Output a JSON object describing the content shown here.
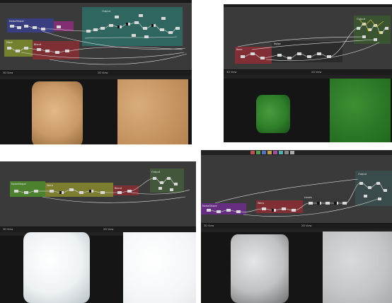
{
  "panels": [
    {
      "frames": [
        "Output",
        "NoiseShape",
        "Blend",
        "Mask"
      ],
      "bar_left": "3D View",
      "bar_right": "2D View"
    },
    {
      "frames": [
        "Output",
        "Base",
        "Noise"
      ],
      "bar_left": "3D View",
      "bar_right": "2D View"
    },
    {
      "frames": [
        "Output",
        "NoiseShape",
        "Warp",
        "Blend"
      ],
      "bar_left": "3D View",
      "bar_right": "2D View"
    },
    {
      "frames": [
        "Output",
        "NoiseShape",
        "Warp",
        "Levels"
      ],
      "bar_left": "3D View",
      "bar_right": "2D View"
    }
  ],
  "colors": {
    "graph_bg": "#3a3a3a",
    "view_bg": "#151515",
    "sandstone": "#c79a66",
    "green": "#2f7f2a",
    "white_plaster": "#eef2f4",
    "marble": "#bfc1c3"
  }
}
